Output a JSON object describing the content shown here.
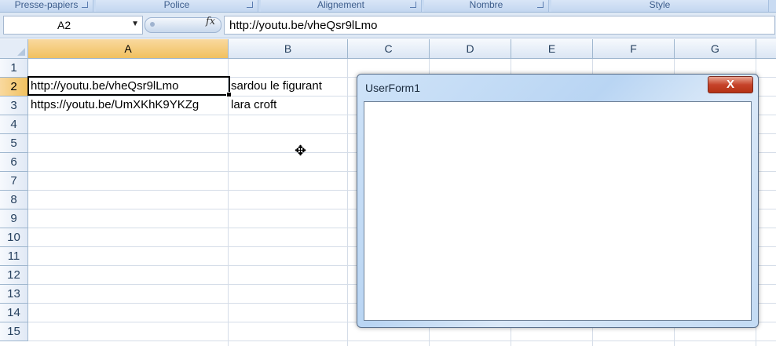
{
  "ribbon": {
    "groups": [
      "Presse-papiers",
      "Police",
      "Alignement",
      "Nombre",
      "Style"
    ]
  },
  "formula_bar": {
    "name_box": "A2",
    "fx_label": "fx",
    "content": "http://youtu.be/vheQsr9lLmo"
  },
  "sheet": {
    "columns": [
      "A",
      "B",
      "C",
      "D",
      "E",
      "F",
      "G"
    ],
    "selected_column": "A",
    "rows": [
      "1",
      "2",
      "3",
      "4",
      "5",
      "6",
      "7",
      "8",
      "9",
      "10",
      "11",
      "12",
      "13",
      "14",
      "15"
    ],
    "selected_row": "2",
    "cells": {
      "A2": "http://youtu.be/vheQsr9lLmo",
      "B2": "sardou le figurant",
      "A3": "https://youtu.be/UmXKhK9YKZg",
      "B3": "lara croft"
    }
  },
  "userform": {
    "title": "UserForm1",
    "close_glyph": "X"
  },
  "colors": {
    "selected_header": "#f1c15f",
    "ribbon": "#c9dbf2",
    "close_button": "#c6432a"
  }
}
